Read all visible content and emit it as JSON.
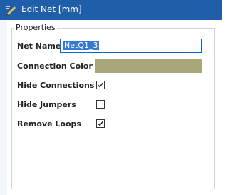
{
  "window": {
    "title": "Edit Net [mm]",
    "app_icon": "edit-net-icon"
  },
  "properties": {
    "group_title": "Properties",
    "net_name": {
      "label": "Net Name",
      "value": "NetQ1_3"
    },
    "connection_color": {
      "label": "Connection Color",
      "color": "#a8a77a"
    },
    "hide_connections": {
      "label": "Hide Connections",
      "checked": true
    },
    "hide_jumpers": {
      "label": "Hide Jumpers",
      "checked": false
    },
    "remove_loops": {
      "label": "Remove Loops",
      "checked": true
    }
  },
  "colors": {
    "titlebar": "#1f5faa",
    "selection": "#3579d6"
  }
}
